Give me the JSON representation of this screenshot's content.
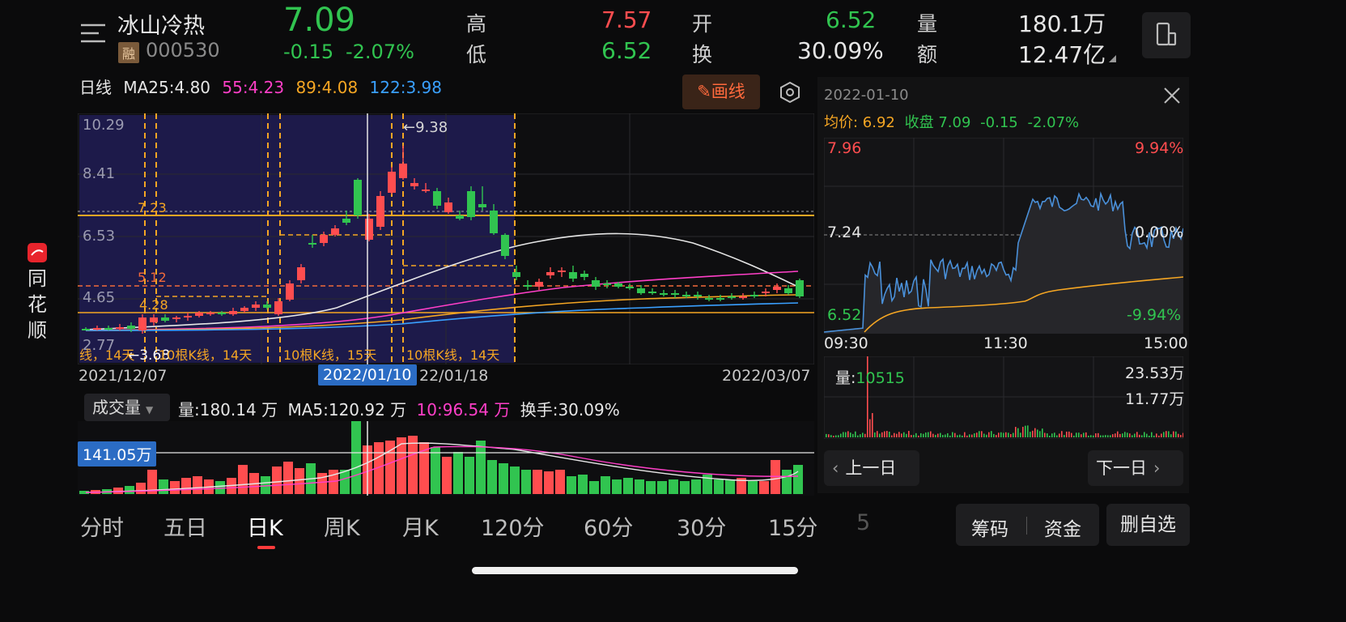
{
  "header": {
    "stock_name": "冰山冷热",
    "badge": "融",
    "code": "000530",
    "price": "7.09",
    "change": "-0.15",
    "change_pct": "-2.07%",
    "high_label": "高",
    "high": "7.57",
    "low_label": "低",
    "low": "6.52",
    "open_label": "开",
    "open": "6.52",
    "turnover_label": "换",
    "turnover": "30.09%",
    "volume_label": "量",
    "volume": "180.1万",
    "amount_label": "额",
    "amount": "12.47亿"
  },
  "sidebar": {
    "brand_chars": [
      "同",
      "花",
      "顺"
    ]
  },
  "kline": {
    "period_label": "日线",
    "ma25": "MA25:4.80",
    "ma55": "55:4.23",
    "ma89": "89:4.08",
    "ma122": "122:3.98",
    "draw_button": "画线",
    "y_ticks": [
      "10.29",
      "8.41",
      "6.53",
      "4.65",
      "2.77"
    ],
    "high_marker": "←9.38",
    "low_marker": "←3.68",
    "level_labels": [
      "7.23",
      "5.12",
      "4.28"
    ],
    "range_labels": [
      "线，14天",
      "10根K线，14天",
      "10根K线，15天",
      "10根K线，14天"
    ],
    "date_start": "2021/12/07",
    "date_cursor": "2022/01/10",
    "date_mid": "22/01/18",
    "date_end": "2022/03/07"
  },
  "volume": {
    "selector": "成交量",
    "vol": "量:180.14 万",
    "ma5": "MA5:120.92 万",
    "ma10": "10:96.54 万",
    "turnover": "换手:30.09%",
    "cursor_value": "141.05万"
  },
  "intraday": {
    "date": "2022-01-10",
    "avg": "均价: 6.92",
    "close": "收盘 7.09",
    "change": "-0.15",
    "change_pct": "-2.07%",
    "top_price": "7.96",
    "top_pct": "9.94%",
    "mid_price": "7.24",
    "mid_pct": "0.00%",
    "bottom_price": "6.52",
    "bottom_pct": "-9.94%",
    "times": [
      "09:30",
      "11:30",
      "15:00"
    ],
    "vol_label": "量:",
    "vol_value": "10515",
    "vol_ticks": [
      "23.53万",
      "11.77万"
    ],
    "prev_day": "上一日",
    "next_day": "下一日"
  },
  "tabs": [
    "分时",
    "五日",
    "日K",
    "周K",
    "月K",
    "120分",
    "60分",
    "30分",
    "15分",
    "5"
  ],
  "active_tab": "日K",
  "bottom_buttons": {
    "chips": "筹码",
    "funds": "资金",
    "remove": "删自选"
  },
  "colors": {
    "up": "#ff4d4f",
    "down": "#31c450",
    "accent": "#f5a623",
    "bg": "#0b0b0c"
  }
}
